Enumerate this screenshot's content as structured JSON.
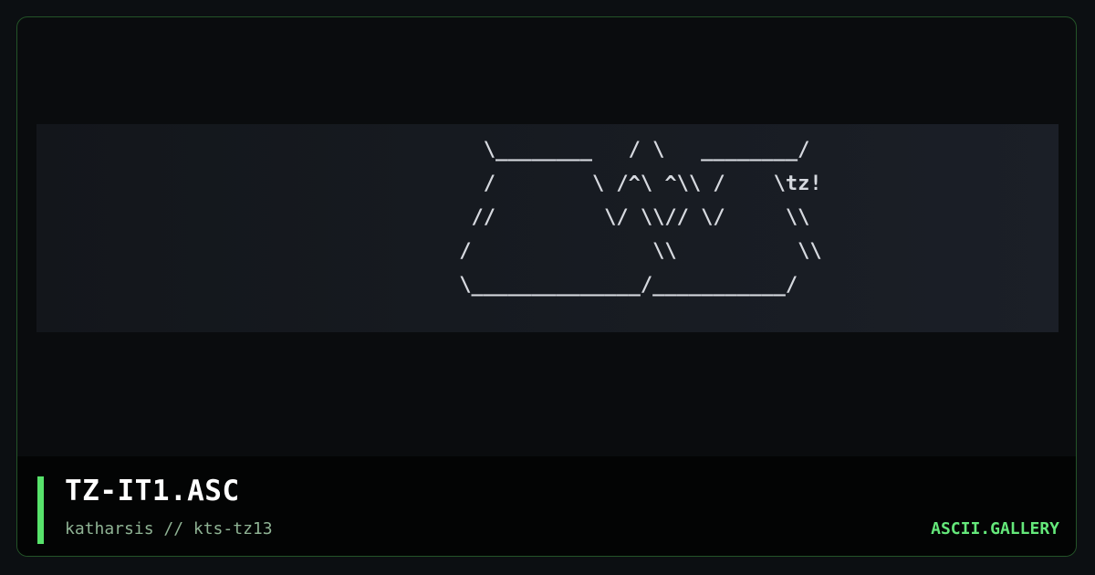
{
  "art": {
    "lines": [
      "   \\________   / \\   ________/",
      "   /        \\ /^\\ ^\\\\ /    \\tz!",
      "  //         \\/ \\\\// \\/     \\\\",
      " /               \\\\          \\\\",
      " \\______________/___________/"
    ]
  },
  "footer": {
    "title": "TZ-IT1.ASC",
    "subtitle": "katharsis // kts-tz13",
    "brand": "ASCII.GALLERY"
  },
  "colors": {
    "accent": "#57e36b",
    "brand": "#64e87a",
    "border": "#245428"
  }
}
